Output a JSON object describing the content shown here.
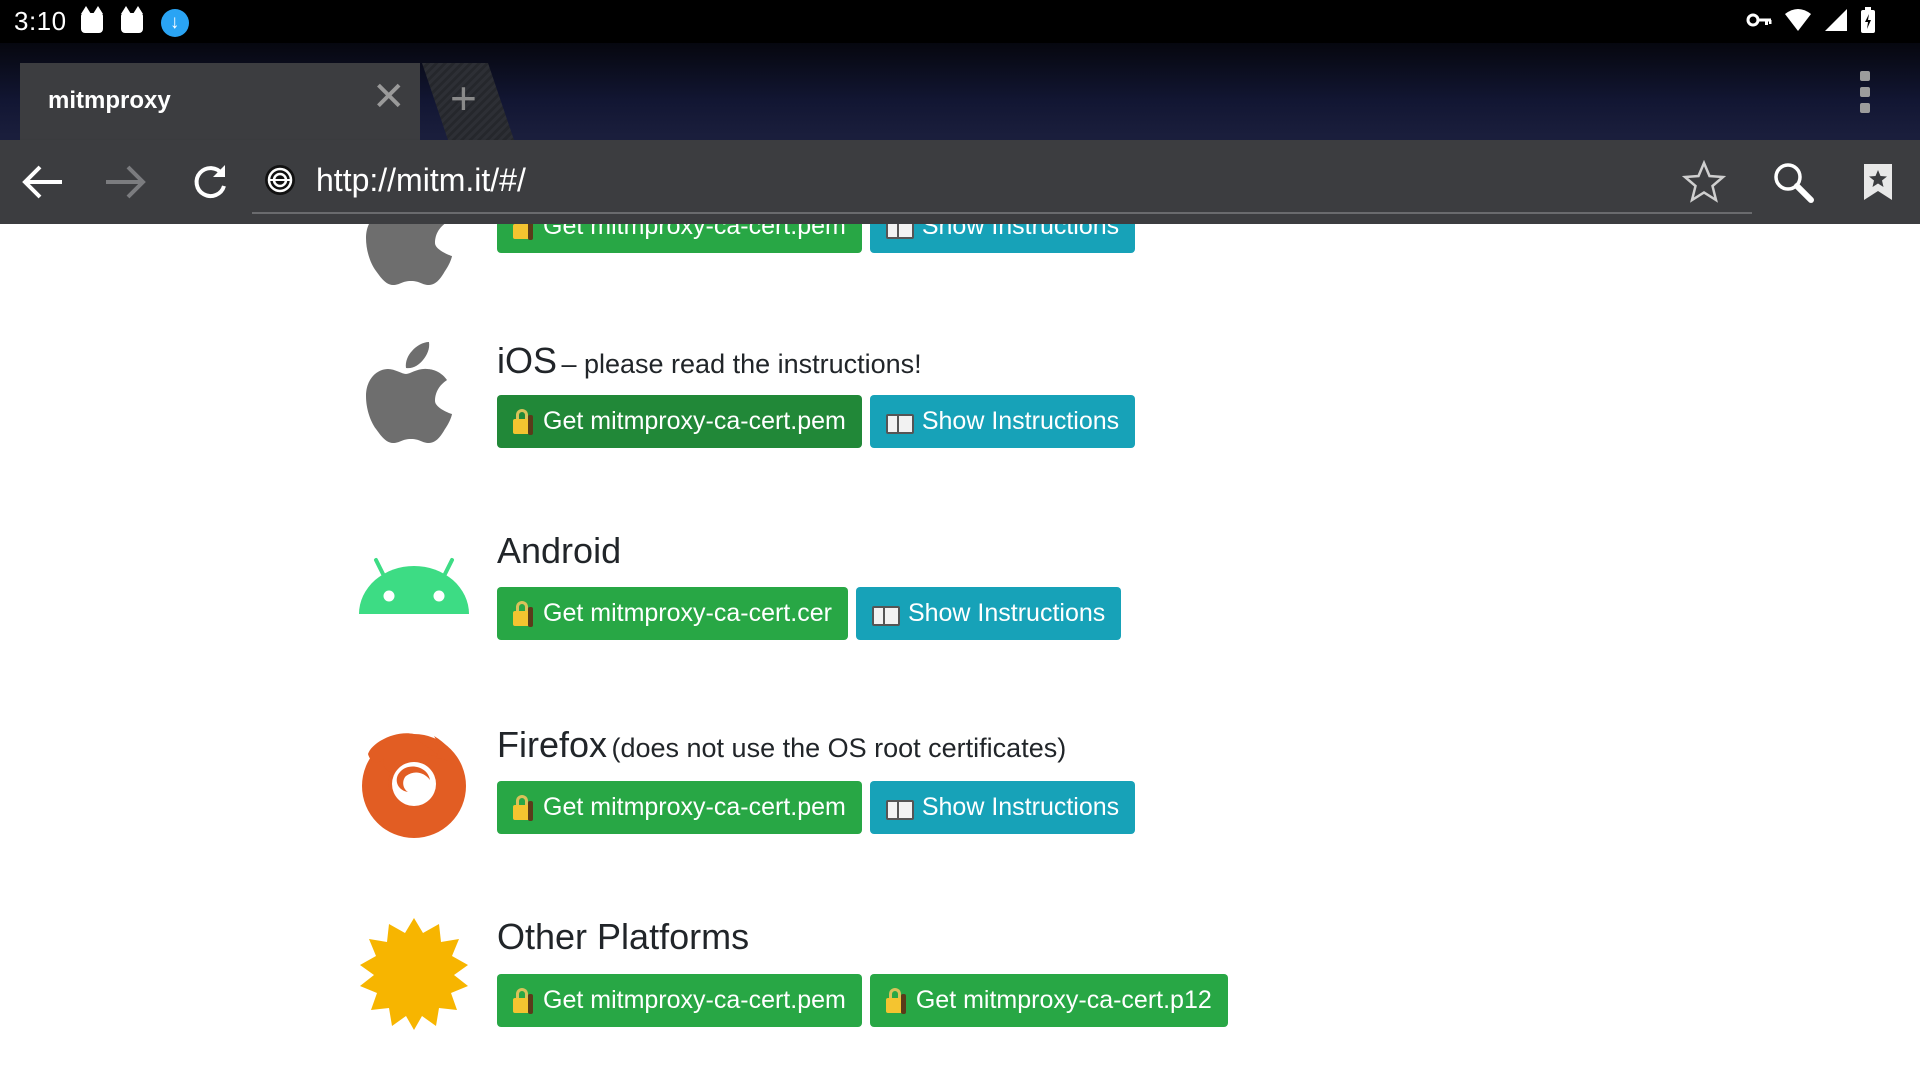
{
  "status_bar": {
    "time": "3:10",
    "icons_left": [
      "cat-icon",
      "cat-icon",
      "download-icon"
    ],
    "icons_right": [
      "vpn-key-icon",
      "wifi-icon",
      "signal-icon",
      "battery-icon"
    ]
  },
  "browser": {
    "tab_title": "mitmproxy",
    "url": "http://mitm.it/#/"
  },
  "platforms": [
    {
      "name": "",
      "note": "",
      "icon": "apple-icon",
      "buttons": [
        {
          "label": "Get mitmproxy-ca-cert.pem",
          "icon": "lock-icon",
          "style": "green"
        },
        {
          "label": "Show Instructions",
          "icon": "book-icon",
          "style": "blue"
        }
      ]
    },
    {
      "name": "iOS",
      "note": "– please read the instructions!",
      "icon": "apple-icon",
      "buttons": [
        {
          "label": "Get mitmproxy-ca-cert.pem",
          "icon": "lock-icon",
          "style": "green"
        },
        {
          "label": "Show Instructions",
          "icon": "book-icon",
          "style": "blue"
        }
      ]
    },
    {
      "name": "Android",
      "note": "",
      "icon": "android-icon",
      "buttons": [
        {
          "label": "Get mitmproxy-ca-cert.cer",
          "icon": "lock-icon",
          "style": "green"
        },
        {
          "label": "Show Instructions",
          "icon": "book-icon",
          "style": "blue"
        }
      ]
    },
    {
      "name": "Firefox",
      "note": "(does not use the OS root certificates)",
      "icon": "firefox-icon",
      "buttons": [
        {
          "label": "Get mitmproxy-ca-cert.pem",
          "icon": "lock-icon",
          "style": "green"
        },
        {
          "label": "Show Instructions",
          "icon": "book-icon",
          "style": "blue"
        }
      ]
    },
    {
      "name": "Other Platforms",
      "note": "",
      "icon": "sun-badge-icon",
      "buttons": [
        {
          "label": "Get mitmproxy-ca-cert.pem",
          "icon": "lock-icon",
          "style": "green"
        },
        {
          "label": "Get mitmproxy-ca-cert.p12",
          "icon": "lock-icon",
          "style": "green"
        }
      ]
    }
  ],
  "colors": {
    "green": "#28a745",
    "green_active": "#218838",
    "blue": "#17a2b8",
    "apple_gray": "#6e6e6e",
    "android_green": "#3ddc84",
    "firefox_orange": "#e25d23",
    "other_yellow": "#f7b500"
  }
}
